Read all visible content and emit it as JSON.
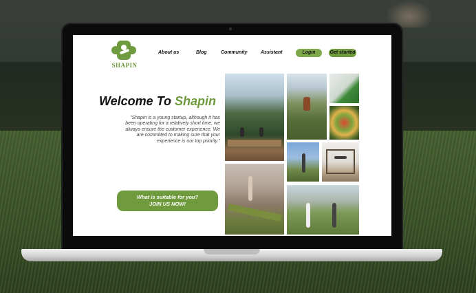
{
  "site": {
    "logo_text": "SHAPIN",
    "nav": [
      "About us",
      "Blog",
      "Community",
      "Assistant"
    ],
    "login_label": "Login",
    "get_started_label": "Get started"
  },
  "hero": {
    "title_prefix": "Welcome To ",
    "title_accent": "Shapin",
    "text": "\"Shapin is a young startup, although it has been operating for a relatively short time, we always ensure the customer experience. We are committed to making sure that your experience is our top priority.\"",
    "cta_line1": "What is suitable for you?",
    "cta_line2": "JOIN US NOW!"
  },
  "gallery": [
    "yoga-mountains-photo",
    "hiker-photo",
    "green-drink-photo",
    "salad-photo",
    "indoor-yoga-photo",
    "sky-yoga-photo",
    "pilates-photo",
    "duo-yoga-photo"
  ],
  "colors": {
    "accent": "#6f9a3d",
    "button": "#7fa84a",
    "text": "#111111"
  }
}
